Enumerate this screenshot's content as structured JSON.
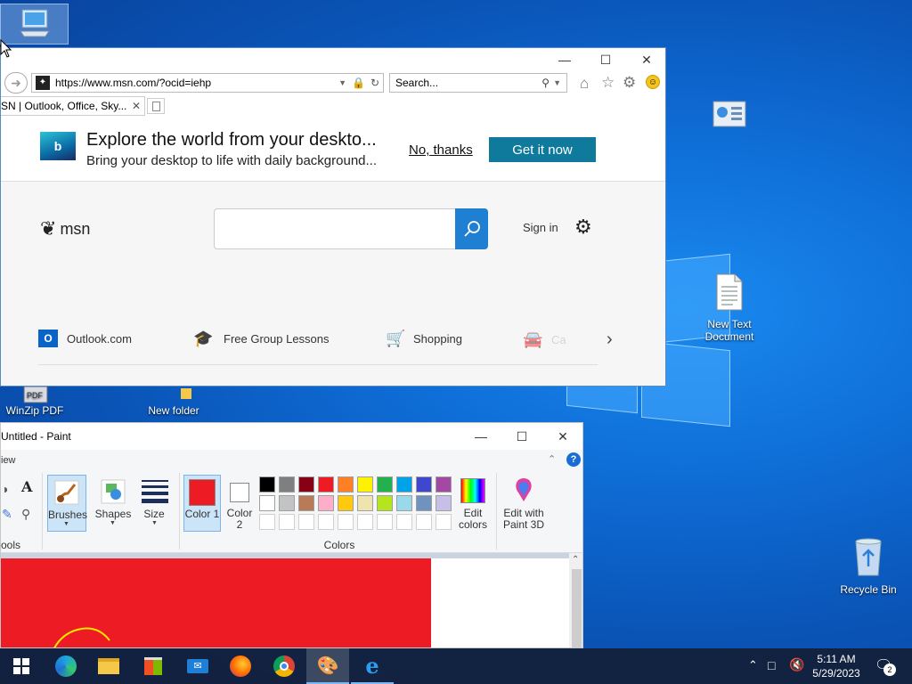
{
  "desktop": {
    "icons": {
      "this_pc": "",
      "new_text_document": "New Text Document",
      "recycle_bin": "Recycle Bin",
      "winzip_pdf": "WinZip PDF",
      "new_folder": "New folder"
    }
  },
  "ie": {
    "url": "https://www.msn.com/?ocid=iehp",
    "search_placeholder": "Search...",
    "tab_title": "SN | Outlook, Office, Sky...",
    "banner": {
      "title": "Explore the world from your deskto...",
      "subtitle": "Bring your desktop to life with daily background...",
      "no_thanks": "No, thanks",
      "get_it_now": "Get it now"
    },
    "msn": {
      "logo_text": "msn",
      "sign_in": "Sign in",
      "links": [
        "Outlook.com",
        "Free Group Lessons",
        "Shopping",
        "Ca"
      ]
    }
  },
  "paint": {
    "title": "Untitled - Paint",
    "menu_view": "iew",
    "tools_label": "ools",
    "brushes": "Brushes",
    "shapes": "Shapes",
    "size": "Size",
    "color1": "Color 1",
    "color2": "Color 2",
    "colors_label": "Colors",
    "edit_colors": "Edit colors",
    "edit_paint3d": "Edit with Paint 3D",
    "palette_row1": [
      "#000000",
      "#7f7f7f",
      "#880015",
      "#ed1c24",
      "#ff7f27",
      "#fff200",
      "#22b14c",
      "#00a2e8",
      "#3f48cc",
      "#a349a4"
    ],
    "palette_row2": [
      "#ffffff",
      "#c3c3c3",
      "#b97a57",
      "#ffaec9",
      "#ffc90e",
      "#efe4b0",
      "#b5e61d",
      "#99d9ea",
      "#7092be",
      "#c8bfe7"
    ],
    "color1_value": "#ed1c24"
  },
  "taskbar": {
    "time": "5:11 AM",
    "date": "5/29/2023",
    "notifications": "2"
  }
}
